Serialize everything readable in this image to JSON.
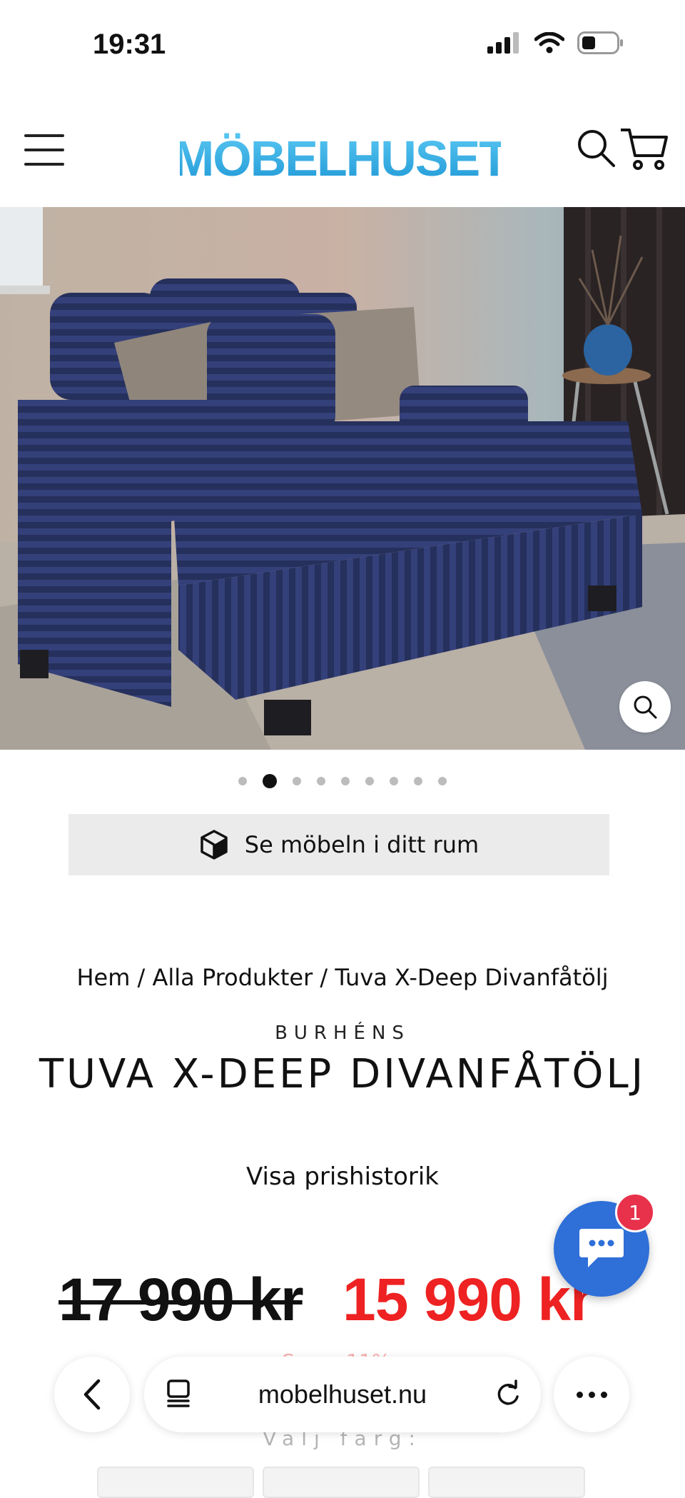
{
  "status": {
    "time": "19:31"
  },
  "header": {
    "brand": "MÖBELHUSET"
  },
  "gallery": {
    "dot_count": 9,
    "active_index": 1
  },
  "ar_button": {
    "label": "Se möbeln i ditt rum"
  },
  "breadcrumb": {
    "text": "Hem / Alla Produkter / Tuva X-Deep Divanfåtölj"
  },
  "product": {
    "vendor": "BURHÉNS",
    "title": "TUVA X-DEEP DIVANFÅTÖLJ",
    "history_link": "Visa prishistorik",
    "price_old": "17 990 kr",
    "price_new": "15 990 kr",
    "discount": "Spara 11%",
    "choose_color": "Välj färg:"
  },
  "chat": {
    "badge": "1"
  },
  "browser": {
    "url": "mobelhuset.nu"
  },
  "colors": {
    "brand": "#3aaee5",
    "sale": "#ee2222",
    "chat": "#2e6fd8",
    "badge": "#e8314b"
  },
  "icons": [
    "hamburger-icon",
    "search-icon",
    "cart-icon",
    "zoom-icon",
    "cube-icon",
    "chat-icon",
    "back-icon",
    "tabs-icon",
    "reload-icon",
    "more-icon"
  ]
}
